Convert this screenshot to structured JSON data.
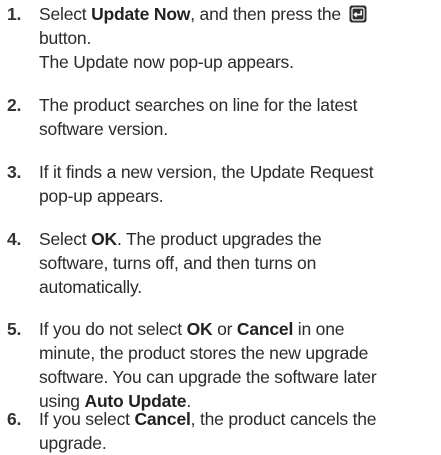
{
  "steps": [
    {
      "number": "1.",
      "lines": [
        {
          "a": "Select ",
          "b": "Update Now",
          "c": ", and then press the"
        },
        {
          "a": "button."
        },
        {
          "a": "The Update now pop-up appears."
        }
      ],
      "icon": "enter-button-icon"
    },
    {
      "number": "2.",
      "lines": [
        {
          "a": "The product searches on line for the latest"
        },
        {
          "a": "software version."
        }
      ]
    },
    {
      "number": "3.",
      "lines": [
        {
          "a": "If it finds a new version, the Update Request"
        },
        {
          "a": "pop-up appears."
        }
      ]
    },
    {
      "number": "4.",
      "lines": [
        {
          "a": "Select ",
          "b": "OK",
          "c": ". The product upgrades the"
        },
        {
          "a": "software, turns off, and then turns on"
        },
        {
          "a": "automatically."
        }
      ]
    },
    {
      "number": "5.",
      "lines": [
        {
          "a": "If you do not select ",
          "b": "OK",
          "c": " or ",
          "d": "Cancel",
          "e": " in one"
        },
        {
          "a": "minute, the product stores the new upgrade"
        },
        {
          "a": "software. You can upgrade the software later"
        },
        {
          "a": "using ",
          "b": "Auto Update",
          "c": "."
        }
      ]
    },
    {
      "number": "6.",
      "lines": [
        {
          "a": "If you select ",
          "b": "Cancel",
          "c": ", the product cancels the"
        },
        {
          "a": "upgrade."
        }
      ]
    }
  ]
}
